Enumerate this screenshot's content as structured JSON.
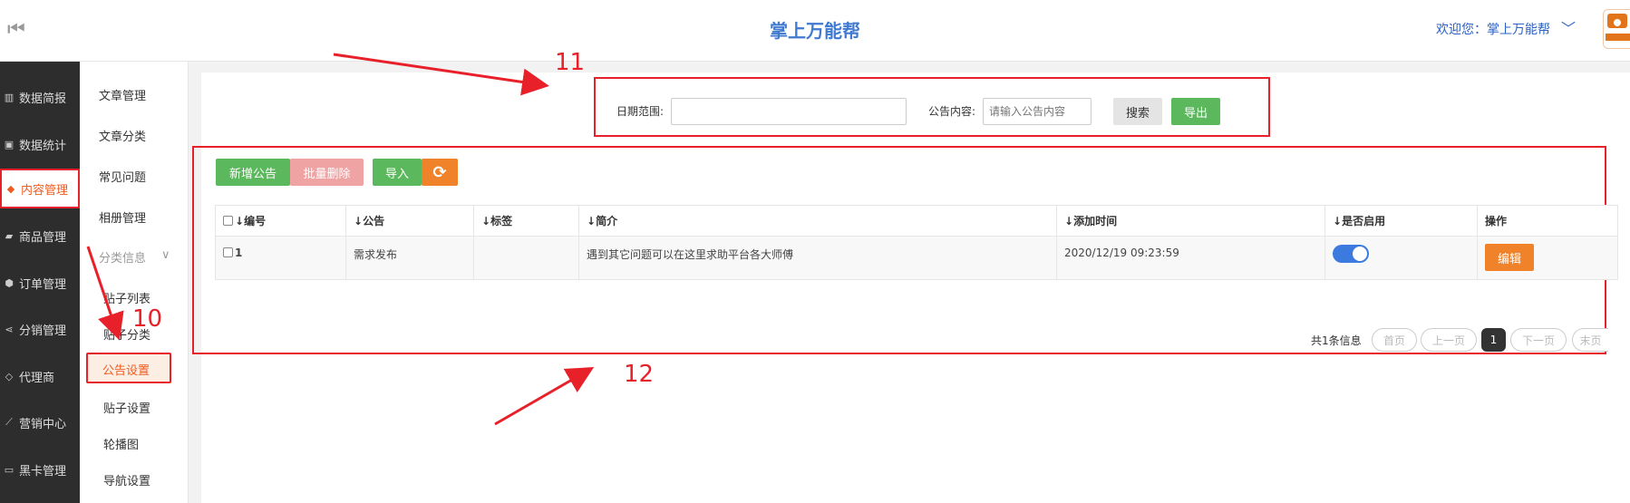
{
  "header": {
    "collapse_icon": "⏮",
    "title": "掌上万能帮",
    "welcome": "欢迎您：掌上万能帮",
    "chevron": "﹀"
  },
  "sidebar": {
    "items": [
      {
        "label": "数据简报",
        "icon": "bar-chart-icon",
        "glyph": "▥"
      },
      {
        "label": "数据统计",
        "icon": "money-icon",
        "glyph": "▣"
      },
      {
        "label": "内容管理",
        "icon": "tag-icon",
        "glyph": "◆"
      },
      {
        "label": "商品管理",
        "icon": "bag-icon",
        "glyph": "▰"
      },
      {
        "label": "订单管理",
        "icon": "cube-icon",
        "glyph": "⬢"
      },
      {
        "label": "分销管理",
        "icon": "share-icon",
        "glyph": "⋖"
      },
      {
        "label": "代理商",
        "icon": "diamond-icon",
        "glyph": "◇"
      },
      {
        "label": "营销中心",
        "icon": "line-chart-icon",
        "glyph": "⟋"
      },
      {
        "label": "黑卡管理",
        "icon": "card-icon",
        "glyph": "▭"
      }
    ]
  },
  "subnav": {
    "items": [
      "文章管理",
      "文章分类",
      "常见问题",
      "相册管理"
    ],
    "group": "分类信息",
    "group_chevron": "∨",
    "group_items": [
      "贴子列表",
      "贴子分类"
    ],
    "active": "公告设置",
    "after_items": [
      "贴子设置",
      "轮播图",
      "导航设置"
    ]
  },
  "search": {
    "date_label": "日期范围:",
    "date_value": "",
    "content_label": "公告内容:",
    "content_placeholder": "请输入公告内容",
    "search_btn": "搜索",
    "export_btn": "导出"
  },
  "toolbar": {
    "add_btn": "新增公告",
    "batch_delete_btn": "批量删除",
    "import_btn": "导入",
    "refresh_icon": "⟳"
  },
  "table": {
    "columns": [
      "编号",
      "公告",
      "标签",
      "简介",
      "添加时间",
      "是否启用",
      "操作"
    ],
    "rows": [
      {
        "id": "1",
        "notice": "需求发布",
        "tag": "",
        "intro": "遇到其它问题可以在这里求助平台各大师傅",
        "time": "2020/12/19 09:23:59",
        "enabled": true,
        "action": "编辑"
      }
    ]
  },
  "pagination": {
    "total": "共1条信息",
    "first": "首页",
    "prev": "上一页",
    "current": "1",
    "next": "下一页",
    "last": "末页"
  },
  "annotations": {
    "a10": "10",
    "a11": "11",
    "a12": "12"
  },
  "colors": {
    "accent": "#3f7ad0",
    "annotation": "#e8202a",
    "active_orange": "#ef5b21",
    "green": "#5cb85c",
    "toggle": "#3c7ae0"
  }
}
